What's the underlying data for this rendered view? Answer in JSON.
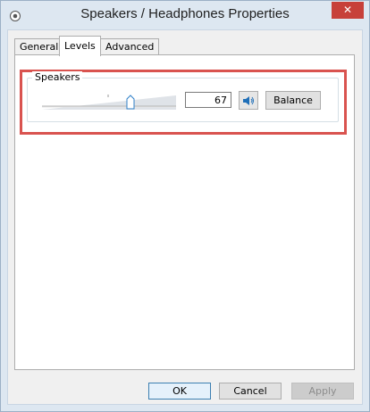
{
  "window": {
    "title": "Speakers / Headphones Properties",
    "close_label": "✕"
  },
  "tabs": [
    {
      "label": "General",
      "active": false
    },
    {
      "label": "Levels",
      "active": true
    },
    {
      "label": "Advanced",
      "active": false
    }
  ],
  "levels": {
    "group_label": "Speakers",
    "volume_value": "67",
    "volume_level_percent": 67,
    "mute_icon": "speaker-icon",
    "balance_label": "Balance"
  },
  "footer": {
    "ok_label": "OK",
    "cancel_label": "Cancel",
    "apply_label": "Apply"
  },
  "colors": {
    "accent": "#3c7fb1",
    "highlight": "#d9534f",
    "close": "#c7403a"
  }
}
